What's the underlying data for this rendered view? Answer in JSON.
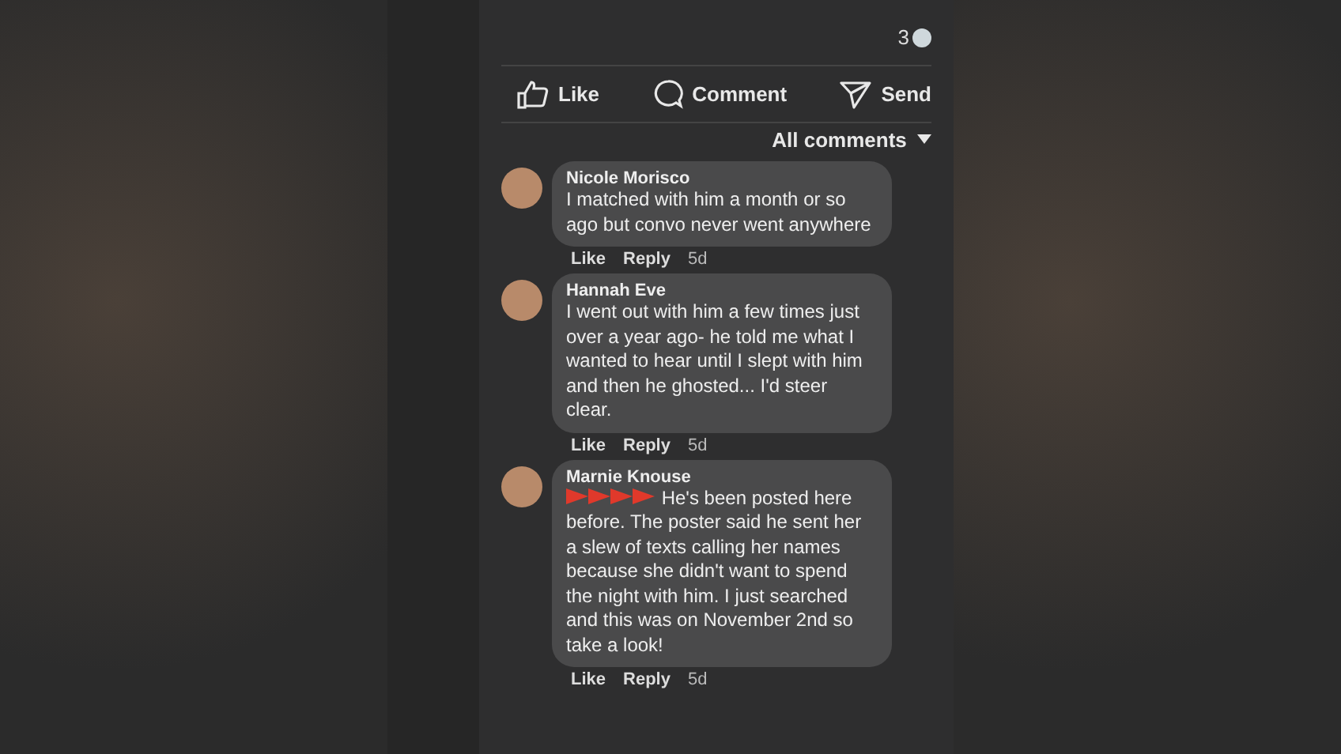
{
  "post": {
    "comment_count": "3"
  },
  "actions": [
    {
      "kind": "like",
      "label": "Like"
    },
    {
      "kind": "comment",
      "label": "Comment"
    },
    {
      "kind": "send",
      "label": "Send"
    }
  ],
  "sort": {
    "label": "All comments"
  },
  "comments": [
    {
      "author": "Nicole Morisco",
      "pointers": false,
      "text": "I matched with him a month or so ago but convo never went anywhere",
      "like": "Like",
      "reply": "Reply",
      "time": "5d"
    },
    {
      "author": "Hannah Eve",
      "pointers": false,
      "text": "I went out with him a few times just over a year ago- he told me what I wanted to hear until I slept with him and then he ghosted... I'd steer clear.",
      "like": "Like",
      "reply": "Reply",
      "time": "5d"
    },
    {
      "author": "Marnie Knouse",
      "pointers": true,
      "text": "He's been posted here before. The poster said he sent her a slew of texts calling her names because she didn't want to spend the night with him. I just searched and this was on November 2nd so take a look!",
      "like": "Like",
      "reply": "Reply",
      "time": "5d"
    }
  ]
}
